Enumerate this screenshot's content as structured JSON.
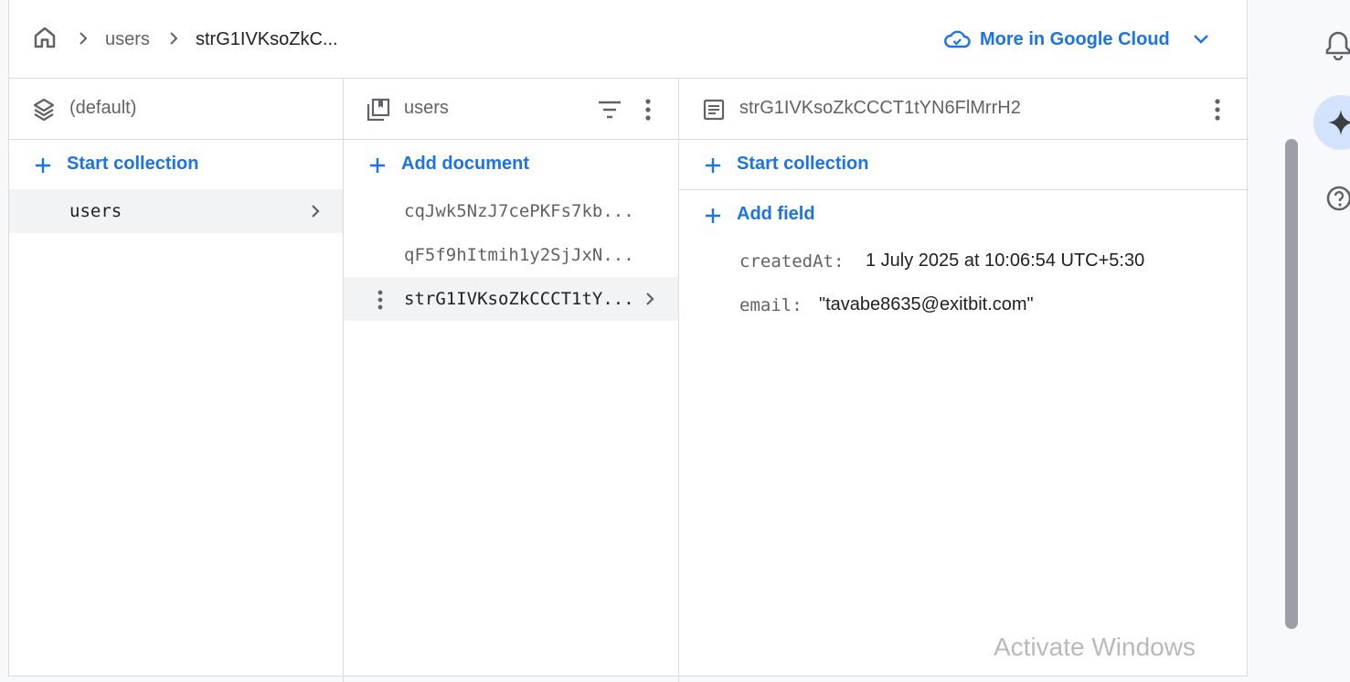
{
  "breadcrumb": {
    "items": [
      "users",
      "strG1IVKsoZkC..."
    ]
  },
  "header": {
    "cloud_label": "More in Google Cloud"
  },
  "panel_database": {
    "title": "(default)",
    "action_label": "Start collection",
    "collections": [
      "users"
    ]
  },
  "panel_collection": {
    "title": "users",
    "action_label": "Add document",
    "documents": [
      "cqJwk5NzJ7cePKFs7kb...",
      "qF5f9hItmih1y2SjJxN...",
      "strG1IVKsoZkCCCT1tY..."
    ]
  },
  "panel_document": {
    "title": "strG1IVKsoZkCCCT1tYN6FlMrrH2",
    "start_collection_label": "Start collection",
    "add_field_label": "Add field",
    "fields": [
      {
        "key": "createdAt:",
        "value": "1 July 2025 at 10:06:54 UTC+5:30"
      },
      {
        "key": "email:",
        "value": "\"tavabe8635@exitbit.com\""
      }
    ]
  },
  "watermark": "Activate Windows",
  "colors": {
    "accent": "#1a73e8",
    "selected_row": "#f1f3f4",
    "border": "#dadce0",
    "muted_text": "#5f6368"
  }
}
